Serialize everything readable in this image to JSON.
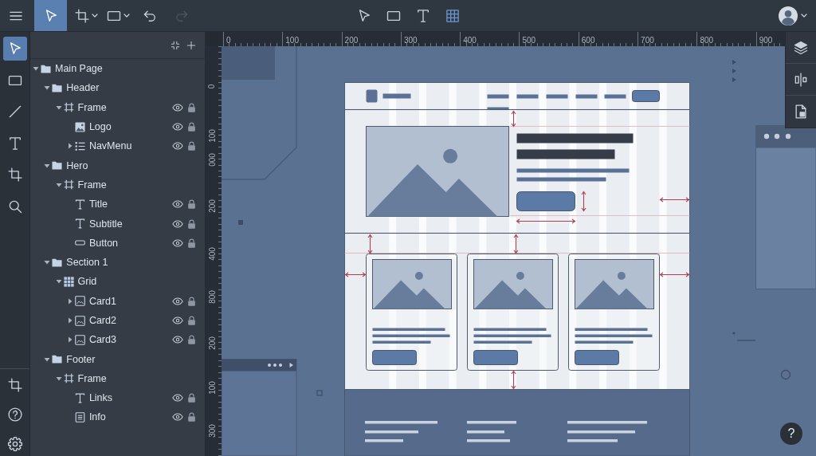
{
  "top_bar": {
    "tools": [
      {
        "kind": "select",
        "selected": true,
        "menu": false
      },
      {
        "kind": "crop",
        "selected": false,
        "menu": true
      },
      {
        "kind": "rectangle",
        "selected": false,
        "menu": true
      }
    ],
    "history": [
      {
        "kind": "undo",
        "disabled": false
      },
      {
        "kind": "redo",
        "disabled": true
      }
    ],
    "view_tools": [
      {
        "kind": "select",
        "selected": false
      },
      {
        "kind": "rectangle",
        "selected": false
      },
      {
        "kind": "text",
        "selected": false
      },
      {
        "kind": "grid",
        "selected": true
      }
    ],
    "account": {
      "menu": true
    }
  },
  "tool_rail": {
    "tools": [
      {
        "kind": "select",
        "selected": true
      },
      {
        "kind": "rectangle",
        "selected": false
      },
      {
        "kind": "line",
        "selected": false
      },
      {
        "kind": "text",
        "selected": false
      },
      {
        "kind": "crop",
        "selected": false
      },
      {
        "kind": "search",
        "selected": false
      }
    ],
    "bottom": [
      {
        "kind": "crop"
      },
      {
        "kind": "help"
      },
      {
        "kind": "settings"
      }
    ]
  },
  "layers": {
    "actions": [
      {
        "kind": "collapse"
      },
      {
        "kind": "add"
      }
    ],
    "items": [
      {
        "name": "Main Page",
        "kind": "folder",
        "expanded": true,
        "children": [
          {
            "name": "Header",
            "kind": "folder",
            "expanded": true,
            "children": [
              {
                "name": "Frame",
                "kind": "frame",
                "expanded": true,
                "visible": true,
                "locked": true,
                "children": [
                  {
                    "name": "Logo",
                    "kind": "image",
                    "visible": true,
                    "locked": true
                  },
                  {
                    "name": "NavMenu",
                    "kind": "list",
                    "expanded": false,
                    "visible": true,
                    "locked": true
                  }
                ]
              }
            ]
          },
          {
            "name": "Hero",
            "kind": "folder",
            "expanded": true,
            "children": [
              {
                "name": "Frame",
                "kind": "frame",
                "expanded": true,
                "children": [
                  {
                    "name": "Title",
                    "kind": "text",
                    "visible": true,
                    "locked": true
                  },
                  {
                    "name": "Subtitle",
                    "kind": "text",
                    "visible": true,
                    "locked": true
                  },
                  {
                    "name": "Button",
                    "kind": "shape",
                    "visible": true,
                    "locked": true
                  }
                ]
              }
            ]
          },
          {
            "name": "Section 1",
            "kind": "folder",
            "expanded": true,
            "children": [
              {
                "name": "Grid",
                "kind": "grid",
                "expanded": true,
                "children": [
                  {
                    "name": "Card1",
                    "kind": "card",
                    "expanded": false,
                    "visible": true,
                    "locked": true
                  },
                  {
                    "name": "Card2",
                    "kind": "card",
                    "expanded": false,
                    "visible": true,
                    "locked": true
                  },
                  {
                    "name": "Card3",
                    "kind": "card",
                    "expanded": false,
                    "visible": true,
                    "locked": true
                  }
                ]
              }
            ]
          },
          {
            "name": "Footer",
            "kind": "folder",
            "expanded": true,
            "children": [
              {
                "name": "Frame",
                "kind": "frame",
                "expanded": true,
                "children": [
                  {
                    "name": "Links",
                    "kind": "text",
                    "visible": true,
                    "locked": true
                  },
                  {
                    "name": "Info",
                    "kind": "document",
                    "visible": true,
                    "locked": true
                  }
                ]
              }
            ]
          }
        ]
      }
    ]
  },
  "rulers": {
    "horizontal": [
      "0",
      "100",
      "200",
      "300",
      "400",
      "500",
      "600",
      "700",
      "800",
      "900"
    ],
    "vertical": [
      "0",
      "100",
      "000",
      "200",
      "400",
      "800",
      "200",
      "100",
      "300"
    ]
  },
  "side_panel": [
    {
      "kind": "layers"
    },
    {
      "kind": "align"
    },
    {
      "kind": "document"
    }
  ],
  "help_button": {
    "label": "?"
  }
}
